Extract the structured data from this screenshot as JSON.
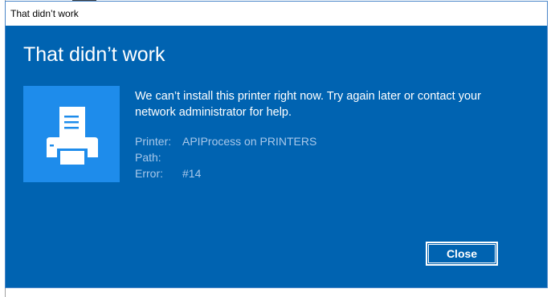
{
  "window": {
    "title": "That didn’t work"
  },
  "dialog": {
    "heading": "That didn’t work",
    "icon": "printer-icon",
    "message": "We can’t install this printer right now. Try again later or contact your network administrator for help.",
    "details": [
      {
        "label": "Printer:",
        "value": "APIProcess on PRINTERS"
      },
      {
        "label": "Path:",
        "value": ""
      },
      {
        "label": "Error:",
        "value": "#14"
      }
    ],
    "close_label": "Close"
  },
  "colors": {
    "dialog_background": "#0063b1",
    "icon_tile": "#1e8ceb",
    "detail_text": "#a8c8ea",
    "text": "#ffffff"
  }
}
